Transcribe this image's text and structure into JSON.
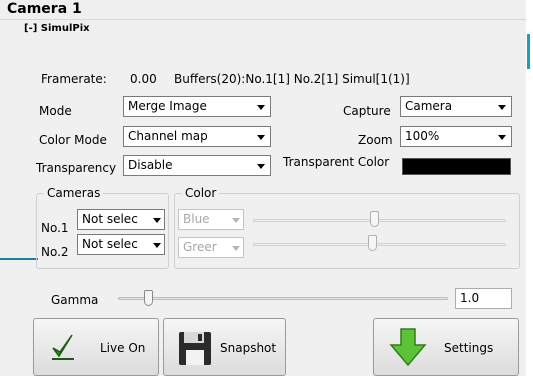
{
  "window": {
    "title": "Camera 1"
  },
  "section": {
    "title": "[-] SimulPix"
  },
  "status": {
    "framerate_label": "Framerate:",
    "framerate_value": "0.00",
    "buffers_text": "Buffers(20):No.1[1] No.2[1] Simul[1(1)]"
  },
  "mode": {
    "label": "Mode",
    "value": "Merge Image"
  },
  "color_mode": {
    "label": "Color Mode",
    "value": "Channel map"
  },
  "transparency": {
    "label": "Transparency",
    "value": "Disable"
  },
  "capture": {
    "label": "Capture",
    "value": "Camera"
  },
  "zoom": {
    "label": "Zoom",
    "value": "100%"
  },
  "transparent_color": {
    "label": "Transparent Color",
    "swatch": "#000000"
  },
  "cameras": {
    "title": "Cameras",
    "no1": {
      "label": "No.1",
      "value": "Not selec"
    },
    "no2": {
      "label": "No.2",
      "value": "Not selec"
    }
  },
  "color": {
    "title": "Color",
    "ch1": {
      "value": "Blue",
      "level": 0.48
    },
    "ch2": {
      "value": "Greer",
      "level": 0.47
    }
  },
  "gamma": {
    "label": "Gamma",
    "value": "1.0",
    "level": 0.09
  },
  "buttons": {
    "live": "Live On",
    "snapshot": "Snapshot",
    "settings": "Settings"
  },
  "colors": {
    "accent_green": "#5cc236",
    "check_green": "#2e9a1e"
  }
}
